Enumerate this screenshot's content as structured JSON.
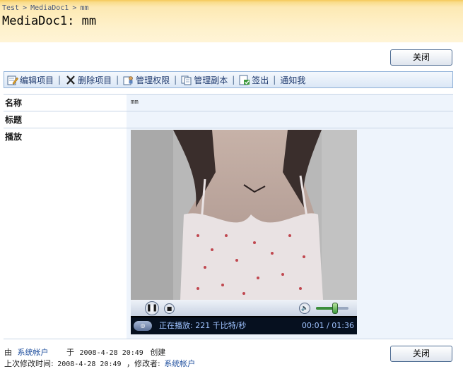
{
  "breadcrumb": {
    "items": [
      "Test",
      "MediaDoc1",
      "mm"
    ],
    "separator": ">"
  },
  "page_title": "MediaDoc1: mm",
  "close_button_label": "关闭",
  "toolbar": {
    "items": [
      {
        "label": "编辑项目",
        "icon": "edit-item-icon"
      },
      {
        "label": "删除项目",
        "icon": "delete-x-icon"
      },
      {
        "label": "管理权限",
        "icon": "permissions-icon"
      },
      {
        "label": "管理副本",
        "icon": "copies-icon"
      },
      {
        "label": "签出",
        "icon": "checkout-icon"
      },
      {
        "label": "通知我",
        "icon": ""
      }
    ],
    "separator": "|"
  },
  "fields": {
    "name_label": "名称",
    "name_value": "mm",
    "title_label": "标题",
    "title_value": "",
    "play_label": "播放"
  },
  "player": {
    "status_text": "正在播放: 221 千比特/秒",
    "time_text": "00:01 / 01:36",
    "volume_level": 0.6,
    "colors": {
      "status_bg": "#06101f",
      "status_text": "#9fc3ff"
    }
  },
  "footer": {
    "by_label": "由",
    "created_by": "系统帐户",
    "at_label": "于",
    "created_at": "2008-4-28 20:49",
    "created_label": "创建",
    "modified_label": "上次修改时间:",
    "modified_at": "2008-4-28 20:49",
    "modified_by_label": "，修改者:",
    "modified_by": "系统帐户"
  },
  "colors": {
    "title_band": "#fde9b3",
    "toolbar_border": "#8fb1d8",
    "link": "#1f4f9e"
  }
}
